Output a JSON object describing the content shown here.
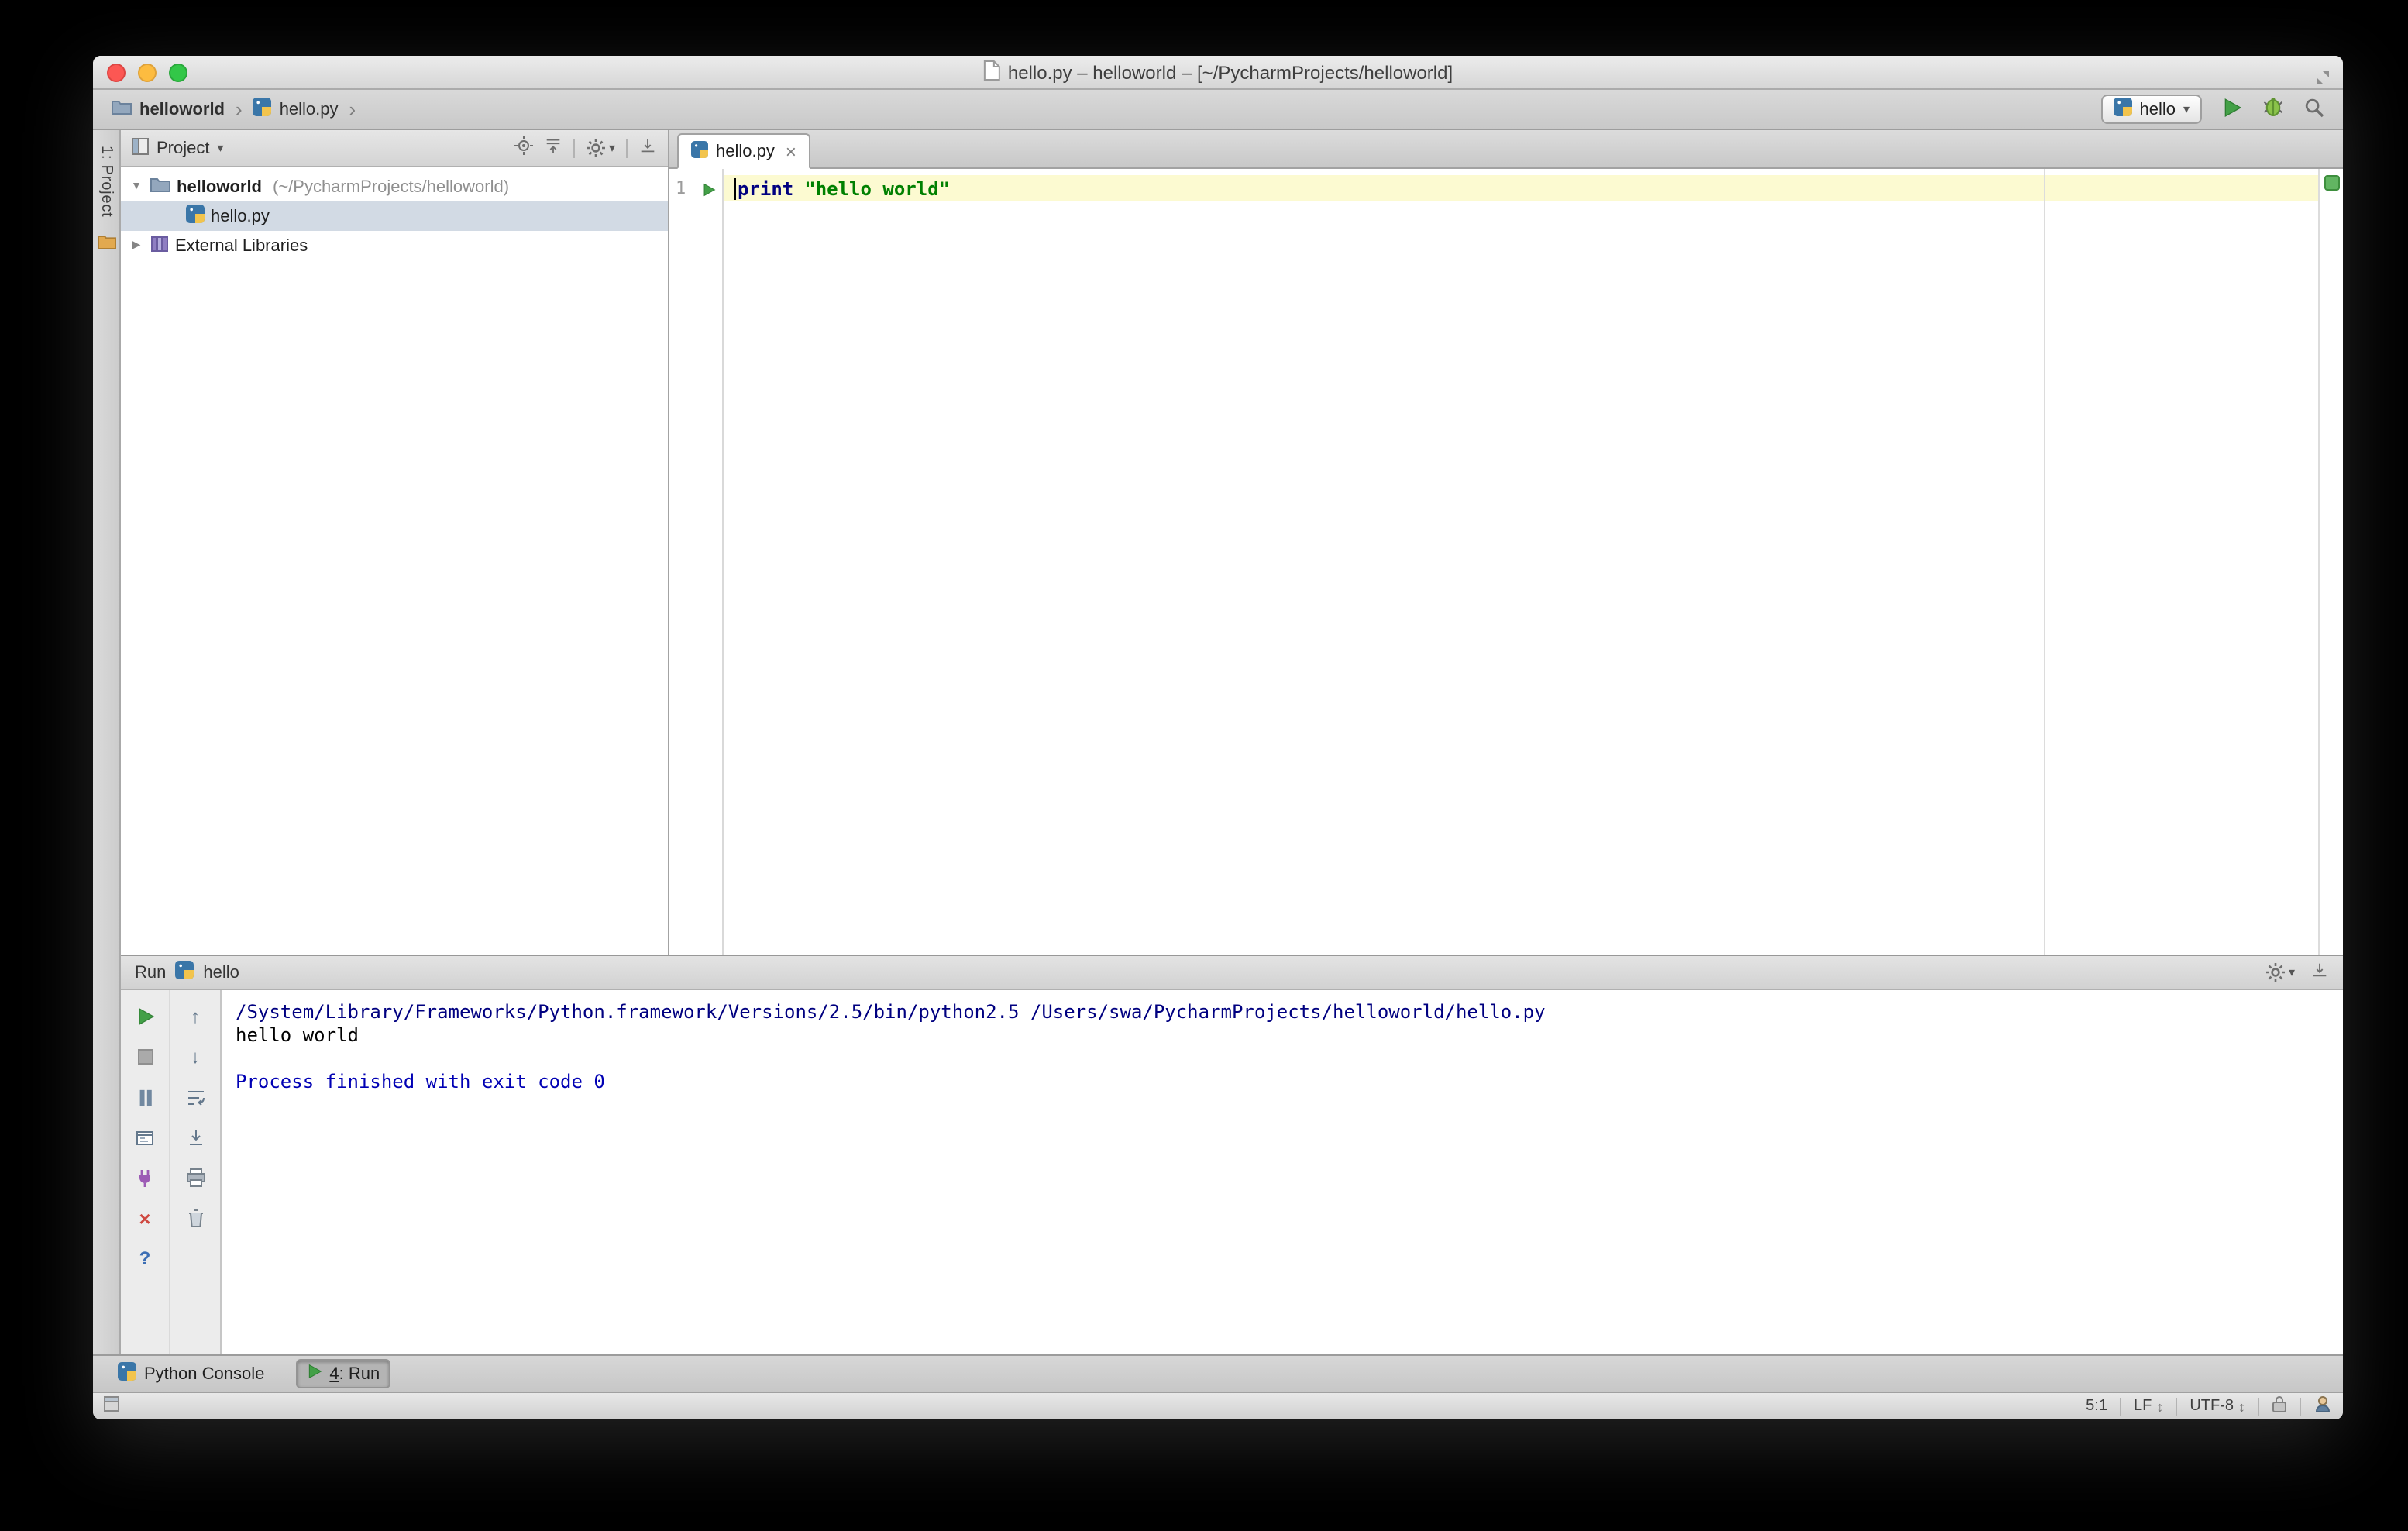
{
  "window": {
    "title": "hello.py – helloworld – [~/PycharmProjects/helloworld]"
  },
  "breadcrumbs": {
    "project": "helloworld",
    "file": "hello.py"
  },
  "nav": {
    "run_config": "hello"
  },
  "stripe": {
    "project_label": "1: Project"
  },
  "project_panel": {
    "header": "Project",
    "project_name": "helloworld",
    "project_path": "(~/PycharmProjects/helloworld)",
    "file_name": "hello.py",
    "external_label": "External Libraries"
  },
  "editor": {
    "tab": "hello.py",
    "line_number": "1",
    "keyword": "print",
    "string": "\"hello world\""
  },
  "run_panel": {
    "title": "Run",
    "config": "hello",
    "console": [
      "/System/Library/Frameworks/Python.framework/Versions/2.5/bin/python2.5 /Users/swa/PycharmProjects/helloworld/hello.py",
      "hello world",
      "",
      "Process finished with exit code 0"
    ]
  },
  "toolwindow_bar": {
    "python_console": "Python Console",
    "run_number": "4",
    "run_suffix": ": Run"
  },
  "status_bar": {
    "position": "5:1",
    "line_separator": "LF",
    "encoding": "UTF-8"
  },
  "icons": {
    "chevron_glyph": "›",
    "dropdown_glyph": "▾",
    "close_glyph": "×",
    "help_glyph": "?",
    "up_glyph": "↑",
    "down_glyph": "↓",
    "updown_glyph": "↕",
    "expand_open_glyph": "▼",
    "expand_closed_glyph": "▶"
  },
  "colors": {
    "keyword": "#000080",
    "string": "#008000",
    "console_command": "#000080",
    "console_info": "#0000b4",
    "run_green": "#43a047",
    "selection_bg": "#d2dae4",
    "current_line": "#fcfad1"
  }
}
